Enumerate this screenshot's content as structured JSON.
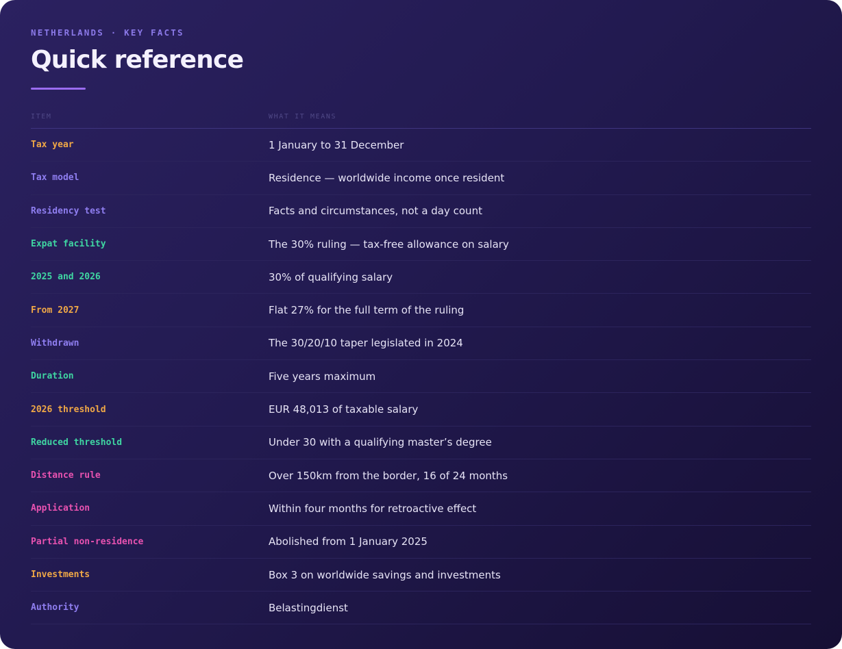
{
  "header": {
    "eyebrow": "NETHERLANDS · KEY FACTS",
    "title": "Quick reference"
  },
  "table": {
    "columns": {
      "item": "ITEM",
      "meaning": "WHAT IT MEANS"
    },
    "rows": [
      {
        "item": "Tax year",
        "meaning": "1 January to 31 December",
        "color": "#f0a846"
      },
      {
        "item": "Tax model",
        "meaning": "Residence — worldwide income once resident",
        "color": "#8f7ef0"
      },
      {
        "item": "Residency test",
        "meaning": "Facts and circumstances, not a day count",
        "color": "#8f7ef0"
      },
      {
        "item": "Expat facility",
        "meaning": "The 30% ruling — tax-free allowance on salary",
        "color": "#3fd6a2"
      },
      {
        "item": "2025 and 2026",
        "meaning": "30% of qualifying salary",
        "color": "#3fd6a2"
      },
      {
        "item": "From 2027",
        "meaning": "Flat 27% for the full term of the ruling",
        "color": "#f0a846"
      },
      {
        "item": "Withdrawn",
        "meaning": "The 30/20/10 taper legislated in 2024",
        "color": "#8f7ef0"
      },
      {
        "item": "Duration",
        "meaning": "Five years maximum",
        "color": "#3fd6a2"
      },
      {
        "item": "2026 threshold",
        "meaning": "EUR 48,013 of taxable salary",
        "color": "#f0a846"
      },
      {
        "item": "Reduced threshold",
        "meaning": "Under 30 with a qualifying master’s degree",
        "color": "#3fd6a2"
      },
      {
        "item": "Distance rule",
        "meaning": "Over 150km from the border, 16 of 24 months",
        "color": "#e852b0"
      },
      {
        "item": "Application",
        "meaning": "Within four months for retroactive effect",
        "color": "#e852b0"
      },
      {
        "item": "Partial non-residence",
        "meaning": "Abolished from 1 January 2025",
        "color": "#e852b0"
      },
      {
        "item": "Investments",
        "meaning": "Box 3 on worldwide savings and investments",
        "color": "#f0a846"
      },
      {
        "item": "Authority",
        "meaning": "Belastingdienst",
        "color": "#8f7ef0"
      }
    ]
  }
}
